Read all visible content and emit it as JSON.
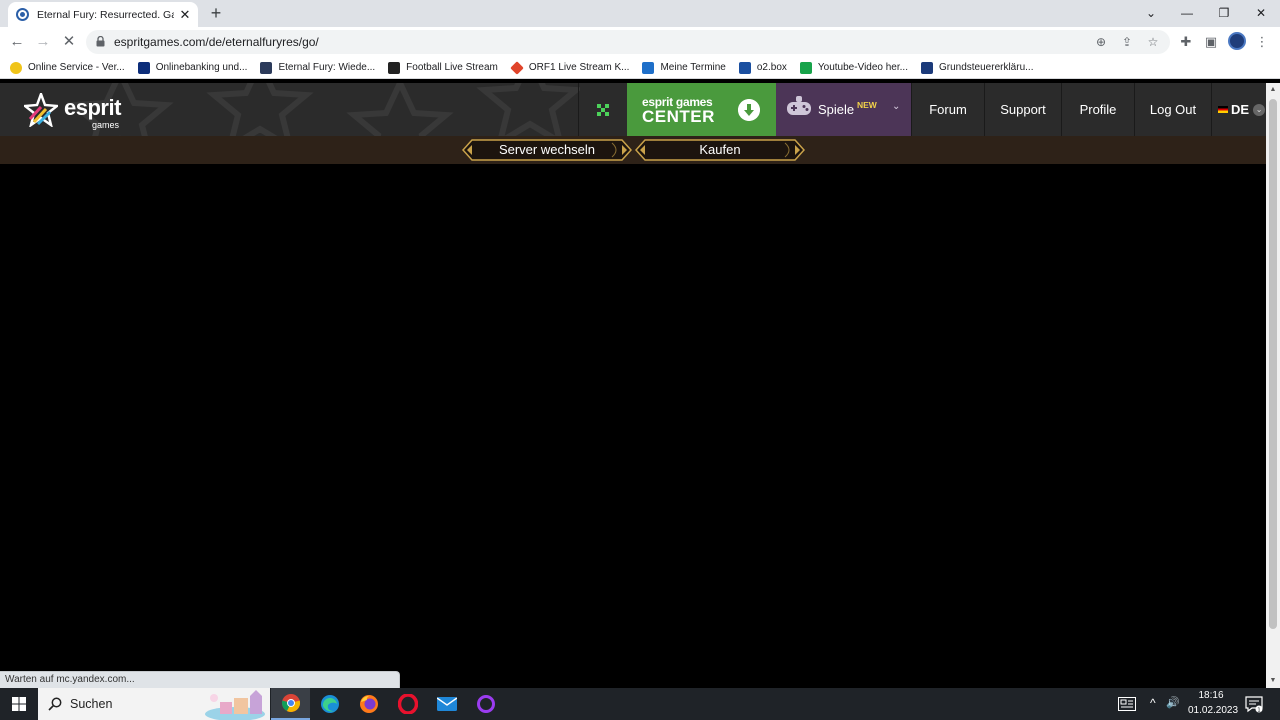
{
  "browser": {
    "tab_title": "Eternal Fury: Resurrected. Game |",
    "tab_close": "✕",
    "new_tab": "+",
    "window_controls": {
      "list": "⌄",
      "minimize": "—",
      "maximize": "❐",
      "close": "✕"
    },
    "nav": {
      "back": "←",
      "forward": "→",
      "reload": "✕"
    },
    "url": "espritgames.com/de/eternalfuryres/go/",
    "omnibox_icons": {
      "zoom": "⊕",
      "share": "⇪",
      "bookmark": "☆"
    },
    "toolbar_icons": {
      "extensions": "✚",
      "side_panel": "▣",
      "menu": "⋮"
    },
    "bookmarks": [
      {
        "label": "Online Service - Ver...",
        "color": "#f0c419"
      },
      {
        "label": "Onlinebanking und...",
        "color": "#0c2d7a"
      },
      {
        "label": "Eternal Fury: Wiede...",
        "color": "#2b3a5a"
      },
      {
        "label": "Football Live Stream",
        "color": "#222222"
      },
      {
        "label": "ORF1 Live Stream K...",
        "color": "#e0442a"
      },
      {
        "label": "Meine Termine",
        "color": "#1e6fc9"
      },
      {
        "label": "o2.box",
        "color": "#1a4fa0"
      },
      {
        "label": "Youtube-Video her...",
        "color": "#17a34a"
      },
      {
        "label": "Grundsteuererkläru...",
        "color": "#1b3a7a"
      }
    ]
  },
  "site": {
    "logo_word": "esprit",
    "logo_sub": "games",
    "fullscreen_icon": "fullscreen-icon",
    "egc_top": "esprit games",
    "egc_bottom": "CENTER",
    "spiele_label": "Spiele",
    "spiele_new": "NEW",
    "spiele_chevron": "⌄",
    "nav": [
      {
        "id": "forum",
        "label": "Forum"
      },
      {
        "id": "support",
        "label": "Support"
      },
      {
        "id": "profile",
        "label": "Profile"
      },
      {
        "id": "logout",
        "label": "Log Out"
      }
    ],
    "lang": "DE",
    "lang_chevron": "⌄",
    "accent_green": "#4a9a3d",
    "accent_purple": "#4c3557",
    "gold": "#c9a24a"
  },
  "subbar": {
    "server_label": "Server wechseln",
    "buy_label": "Kaufen"
  },
  "status_text": "Warten auf mc.yandex.com...",
  "scrollbar": {
    "up": "▲",
    "down": "▼"
  },
  "taskbar": {
    "search_label": "Suchen",
    "tray_chevron": "^",
    "tray_volume": "🔊",
    "time": "18:16",
    "date": "01.02.2023"
  }
}
